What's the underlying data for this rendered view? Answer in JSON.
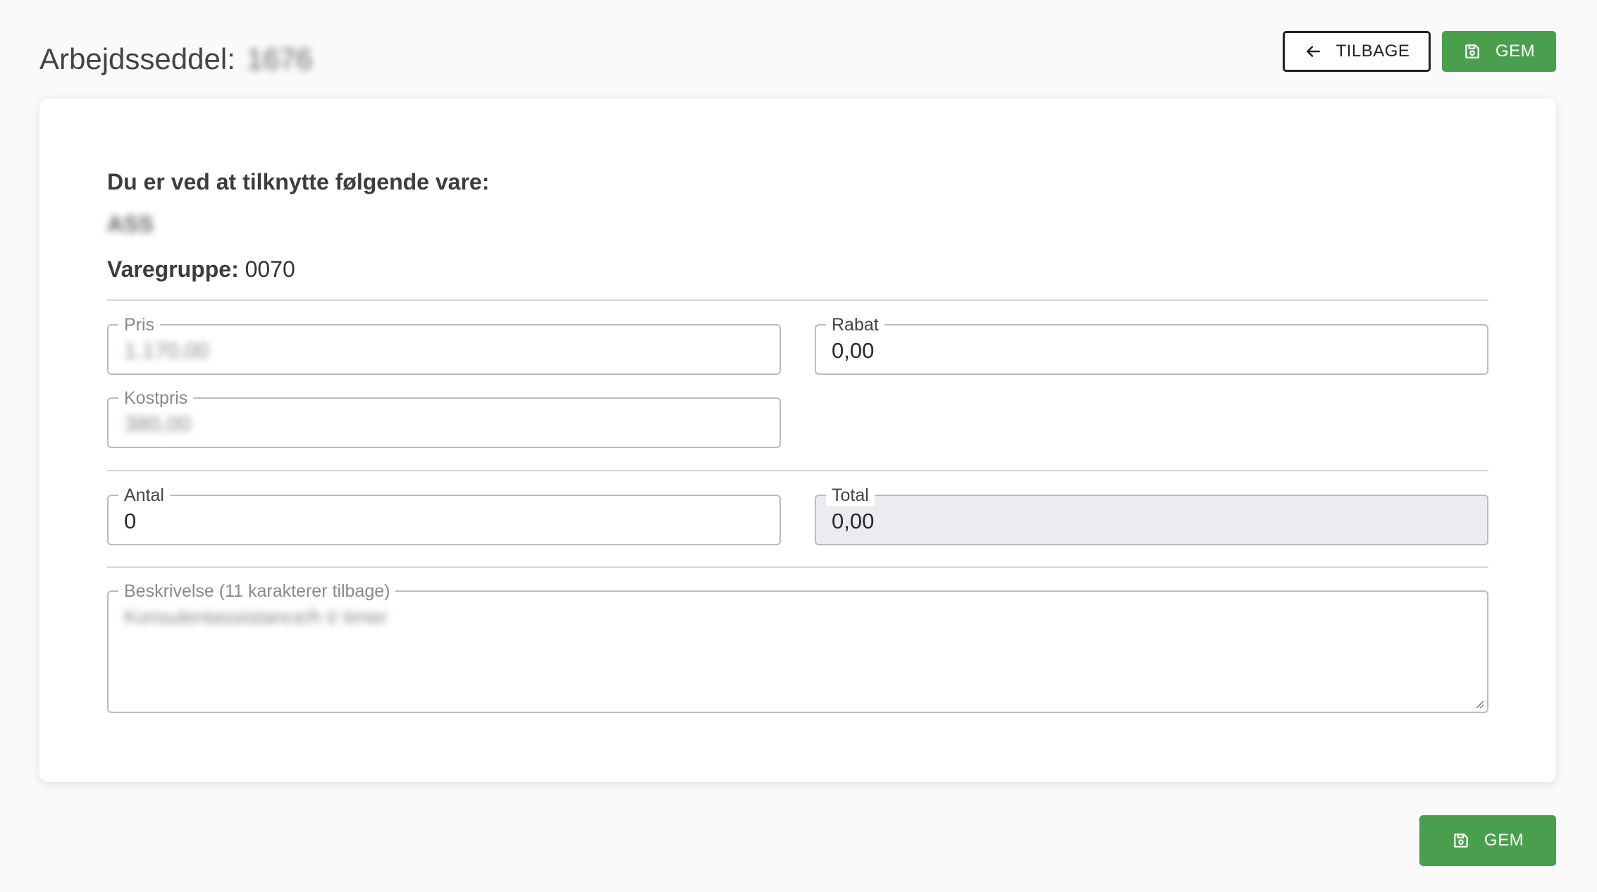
{
  "header": {
    "title": "Arbejdsseddel:",
    "order_number": "1676",
    "back_label": "TILBAGE",
    "save_label": "GEM"
  },
  "form": {
    "intro_heading": "Du er ved at tilknytte følgende vare:",
    "item_name": "ASS",
    "group_label": "Varegruppe:",
    "group_value": "0070",
    "fields": {
      "pris": {
        "label": "Pris",
        "value": "1.170,00"
      },
      "rabat": {
        "label": "Rabat",
        "value": "0,00"
      },
      "kostpris": {
        "label": "Kostpris",
        "value": "380,00"
      },
      "antal": {
        "label": "Antal",
        "value": "0"
      },
      "total": {
        "label": "Total",
        "value": "0,00"
      },
      "beskrivelse": {
        "label": "Beskrivelse (11 karakterer tilbage)",
        "value": "Konsulentassistance/h t/ timer"
      }
    }
  },
  "footer": {
    "save_label": "GEM"
  },
  "colors": {
    "primary_green": "#4a9f4f",
    "background": "#fafafa",
    "disabled_field": "#ebecef"
  }
}
